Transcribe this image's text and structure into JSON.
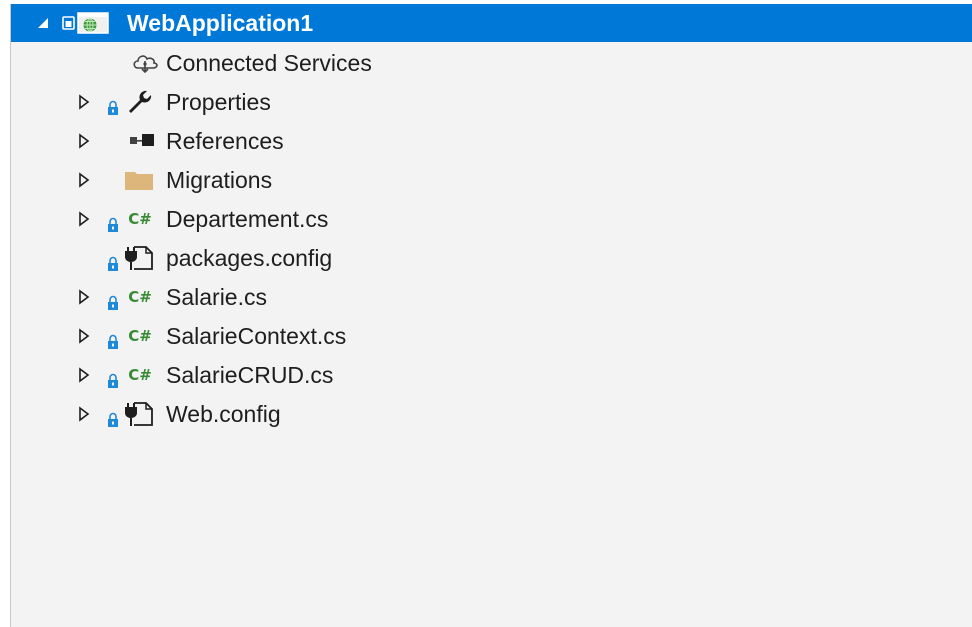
{
  "tree": {
    "root": {
      "label": "WebApplication1",
      "expanded": true,
      "icon": "web-project-icon"
    },
    "items": [
      {
        "label": "Connected Services",
        "icon": "cloud-services-icon",
        "expander": false,
        "lock": false
      },
      {
        "label": "Properties",
        "icon": "wrench-icon",
        "expander": true,
        "lock": true
      },
      {
        "label": "References",
        "icon": "references-icon",
        "expander": true,
        "lock": false
      },
      {
        "label": "Migrations",
        "icon": "folder-icon",
        "expander": true,
        "lock": false
      },
      {
        "label": "Departement.cs",
        "icon": "csharp-file-icon",
        "expander": true,
        "lock": true
      },
      {
        "label": "packages.config",
        "icon": "config-file-icon",
        "expander": false,
        "lock": true
      },
      {
        "label": "Salarie.cs",
        "icon": "csharp-file-icon",
        "expander": true,
        "lock": true
      },
      {
        "label": "SalarieContext.cs",
        "icon": "csharp-file-icon",
        "expander": true,
        "lock": true
      },
      {
        "label": "SalarieCRUD.cs",
        "icon": "csharp-file-icon",
        "expander": true,
        "lock": true
      },
      {
        "label": "Web.config",
        "icon": "config-file-icon",
        "expander": true,
        "lock": true
      }
    ],
    "csharp_glyph": "C#"
  },
  "colors": {
    "selection": "#0078d7",
    "panel_bg": "#f3f3f3",
    "csharp": "#388a34",
    "lock": "#1e88d9",
    "folder": "#dcb67a"
  }
}
